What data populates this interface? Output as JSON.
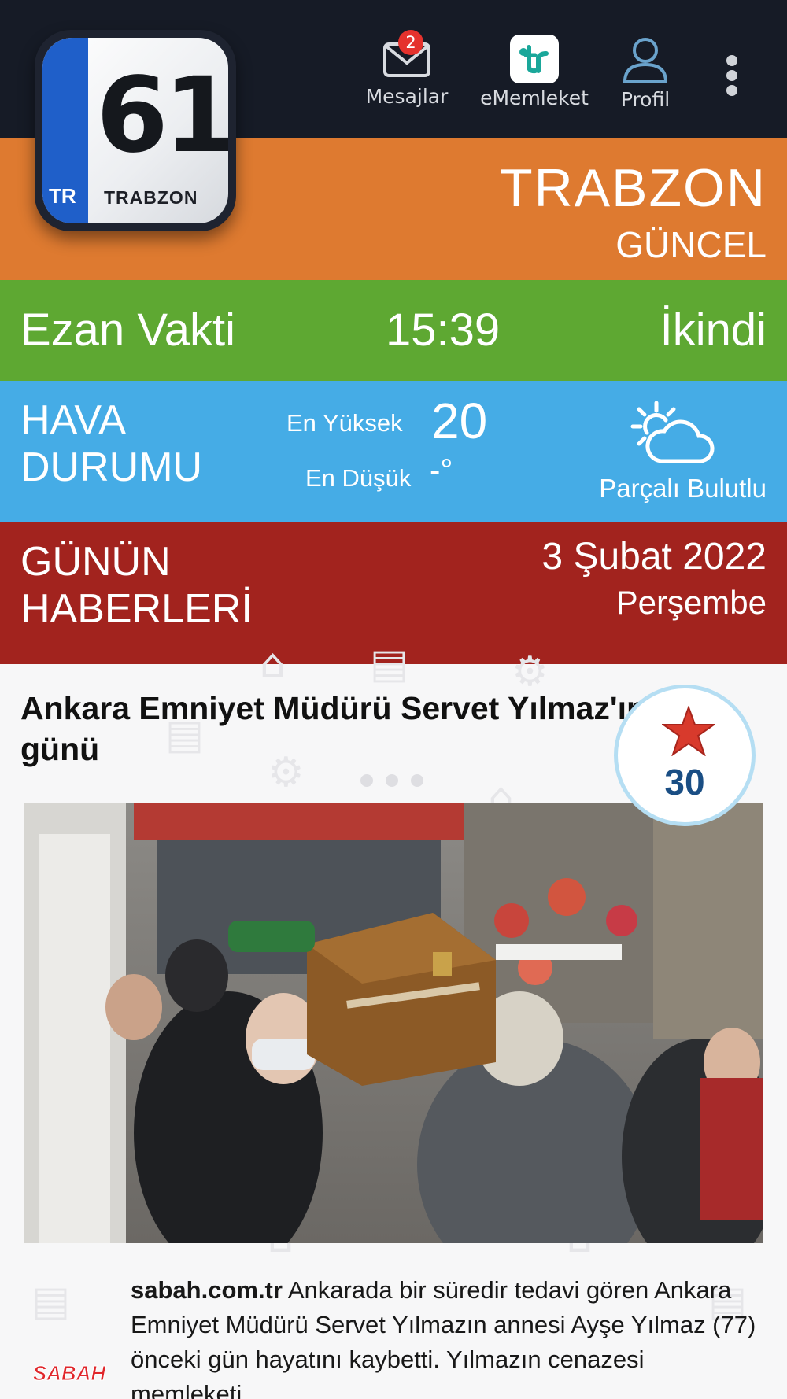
{
  "topbar": {
    "messages_label": "Mesajlar",
    "messages_badge": "2",
    "ememleket_label": "eMemleket",
    "profile_label": "Profil",
    "menu_icon": "more-vertical-icon"
  },
  "logo": {
    "plate_number": "61",
    "country_code": "TR",
    "plate_city": "TRABZON"
  },
  "city": {
    "name": "TRABZON",
    "subtitle": "GÜNCEL"
  },
  "prayer": {
    "label": "Ezan Vakti",
    "time": "15:39",
    "name": "İkindi"
  },
  "weather": {
    "title_line1": "HAVA",
    "title_line2": "DURUMU",
    "high_label": "En Yüksek",
    "high_value": "20",
    "low_label": "En Düşük",
    "low_value": "-°",
    "condition": "Parçalı Bulutlu",
    "icon": "partly-cloudy-icon"
  },
  "news_header": {
    "title_line1": "GÜNÜN",
    "title_line2": "HABERLERİ",
    "date": "3 Şubat 2022",
    "weekday": "Perşembe"
  },
  "article": {
    "headline": "Ankara Emniyet Müdürü Servet Yılmaz'ın acı günü",
    "score": "30",
    "source_name": "sabah.com.tr",
    "source_logo_text": "SABAH",
    "summary": "Ankarada bir süredir tedavi gören Ankara Emniyet Müdürü Servet Yılmazın annesi Ayşe Yılmaz (77) önceki gün hayatını kaybetti. Yılmazın cenazesi memleketi"
  },
  "colors": {
    "topbar": "#161b26",
    "city_band": "#de7a30",
    "prayer_band": "#5ea832",
    "weather_band": "#45ace6",
    "news_band": "#a2231e",
    "badge": "#e5322d",
    "score_text": "#1a4e84"
  }
}
